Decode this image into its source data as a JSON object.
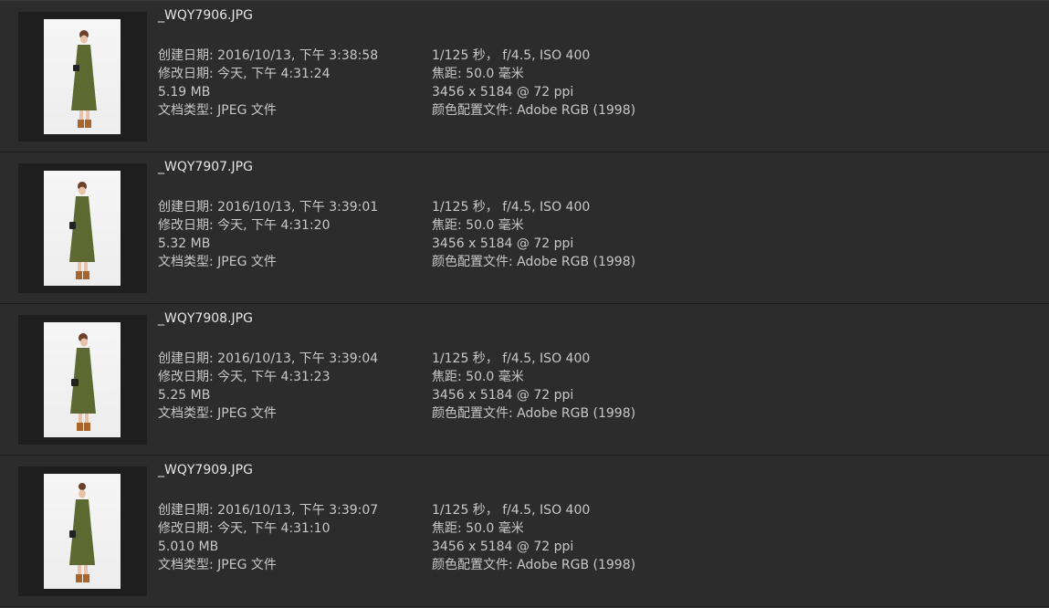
{
  "files": [
    {
      "name": "_WQY7906.JPG",
      "created": "创建日期: 2016/10/13, 下午 3:38:58",
      "modified": "修改日期: 今天, 下午 4:31:24",
      "size": "5.19 MB",
      "doc_type": "文档类型: JPEG 文件",
      "exposure": "1/125 秒，  f/4.5, ISO 400",
      "focal": "焦距: 50.0 毫米",
      "dimensions": "3456 x 5184 @ 72 ppi",
      "color_profile": "颜色配置文件: Adobe RGB (1998)"
    },
    {
      "name": "_WQY7907.JPG",
      "created": "创建日期: 2016/10/13, 下午 3:39:01",
      "modified": "修改日期: 今天, 下午 4:31:20",
      "size": "5.32 MB",
      "doc_type": "文档类型: JPEG 文件",
      "exposure": "1/125 秒，  f/4.5, ISO 400",
      "focal": "焦距: 50.0 毫米",
      "dimensions": "3456 x 5184 @ 72 ppi",
      "color_profile": "颜色配置文件: Adobe RGB (1998)"
    },
    {
      "name": "_WQY7908.JPG",
      "created": "创建日期: 2016/10/13, 下午 3:39:04",
      "modified": "修改日期: 今天, 下午 4:31:23",
      "size": "5.25 MB",
      "doc_type": "文档类型: JPEG 文件",
      "exposure": "1/125 秒，  f/4.5, ISO 400",
      "focal": "焦距: 50.0 毫米",
      "dimensions": "3456 x 5184 @ 72 ppi",
      "color_profile": "颜色配置文件: Adobe RGB (1998)"
    },
    {
      "name": "_WQY7909.JPG",
      "created": "创建日期: 2016/10/13, 下午 3:39:07",
      "modified": "修改日期: 今天, 下午 4:31:10",
      "size": "5.010 MB",
      "doc_type": "文档类型: JPEG 文件",
      "exposure": "1/125 秒，  f/4.5, ISO 400",
      "focal": "焦距: 50.0 毫米",
      "dimensions": "3456 x 5184 @ 72 ppi",
      "color_profile": "颜色配置文件: Adobe RGB (1998)"
    }
  ],
  "colors": {
    "background": "#2c2c2c",
    "thumbnail_frame": "#1e1e1e",
    "text": "#c8c8c8",
    "filename_text": "#e6e6e6"
  }
}
